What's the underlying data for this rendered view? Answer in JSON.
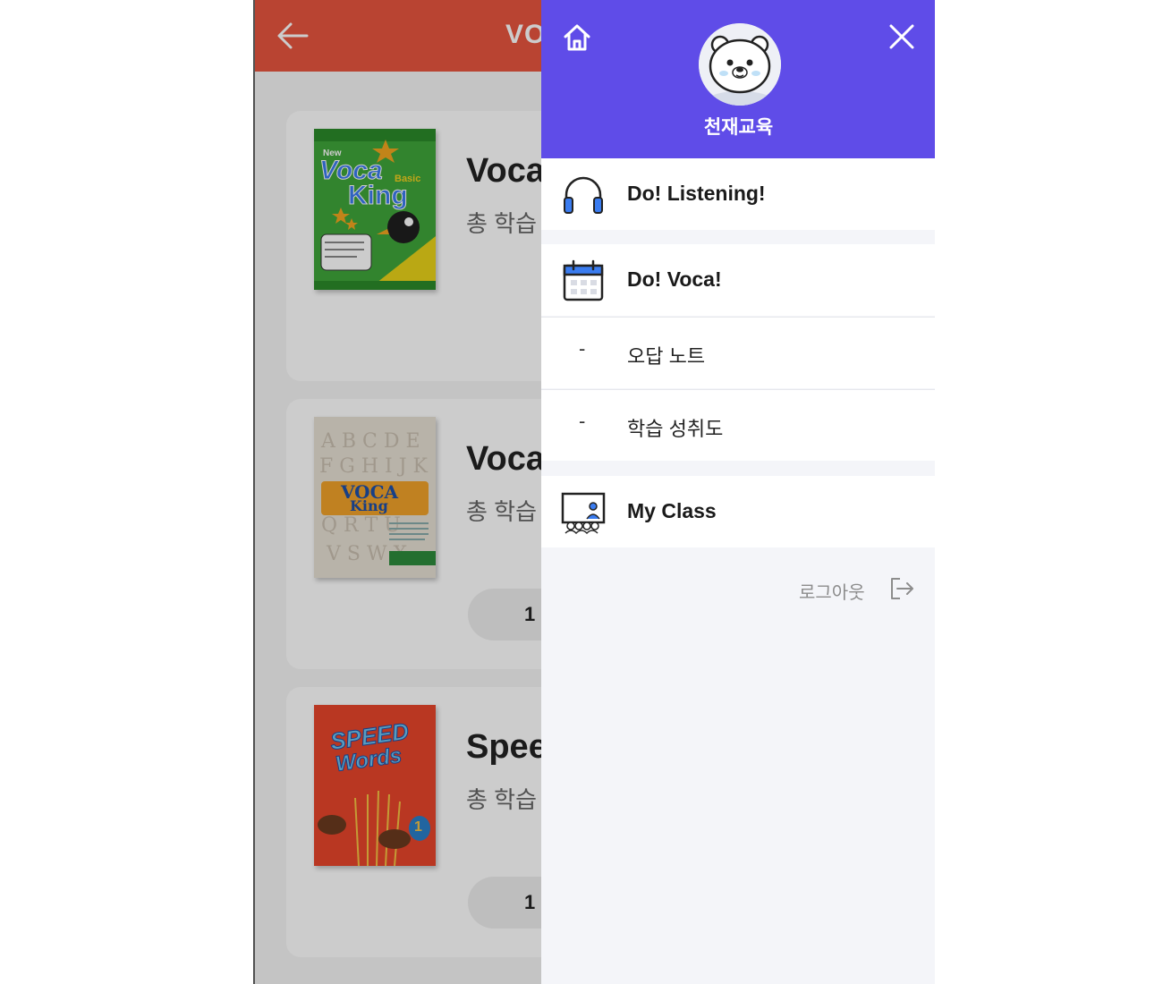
{
  "background_page": {
    "title": "VO",
    "books": [
      {
        "title": "Voca",
        "subtitle": "총 학습",
        "count": "",
        "cover": {
          "brand": "New",
          "line1": "Voca",
          "line2": "King",
          "tag": "Basic"
        }
      },
      {
        "title": "Voca",
        "subtitle": "총 학습",
        "count": "1",
        "cover": {
          "line1": "VOCA",
          "line2": "King"
        }
      },
      {
        "title": "Spee",
        "subtitle": "총 학습",
        "count": "1",
        "cover": {
          "line1": "SPEED",
          "line2": "Words",
          "number": "1"
        }
      }
    ]
  },
  "drawer": {
    "user_name": "천재교육",
    "menu": [
      {
        "label": "Do! Listening!",
        "icon": "headphones-icon"
      },
      {
        "label": "Do! Voca!",
        "icon": "calendar-icon"
      },
      {
        "label": "My Class",
        "icon": "classroom-icon"
      }
    ],
    "sub_menu": [
      {
        "dash": "-",
        "label": "오답 노트"
      },
      {
        "dash": "-",
        "label": "학습 성취도"
      }
    ],
    "logout_label": "로그아웃"
  },
  "colors": {
    "header_bg": "#e8553f",
    "drawer_header_bg": "#5f4ce8",
    "icon_blue": "#3a7cf0"
  }
}
